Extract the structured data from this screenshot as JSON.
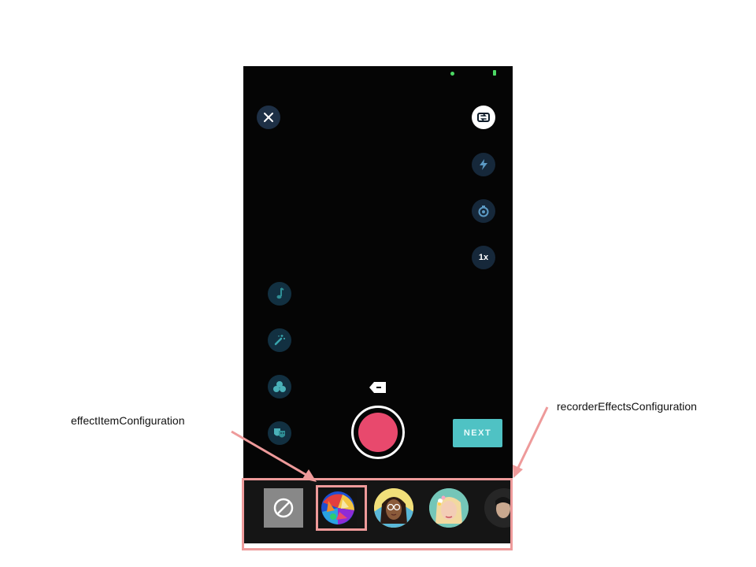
{
  "recorder": {
    "zoom_label": "1x",
    "next_label": "NEXT",
    "record_color": "#e8496d",
    "next_color": "#4fc2c4"
  },
  "top_controls": [
    {
      "name": "close-icon",
      "interactable": true
    },
    {
      "name": "switch-camera-icon",
      "interactable": true
    }
  ],
  "right_controls": [
    "flash-icon",
    "timer-icon",
    "zoom-button"
  ],
  "left_controls": [
    "music-note-icon",
    "magic-wand-icon",
    "color-filter-icon",
    "masks-icon"
  ],
  "effects": [
    {
      "name": "no-effect",
      "icon": "block-icon"
    },
    {
      "name": "colorful-effect",
      "selected": true
    },
    {
      "name": "glasses-girl-effect"
    },
    {
      "name": "flower-crown-effect"
    },
    {
      "name": "dark-portrait-effect"
    }
  ],
  "annotations": {
    "effect_item_label": "effectItemConfiguration",
    "recorder_effects_label": "recorderEffectsConfiguration",
    "highlight_color": "#ee9a9a"
  }
}
